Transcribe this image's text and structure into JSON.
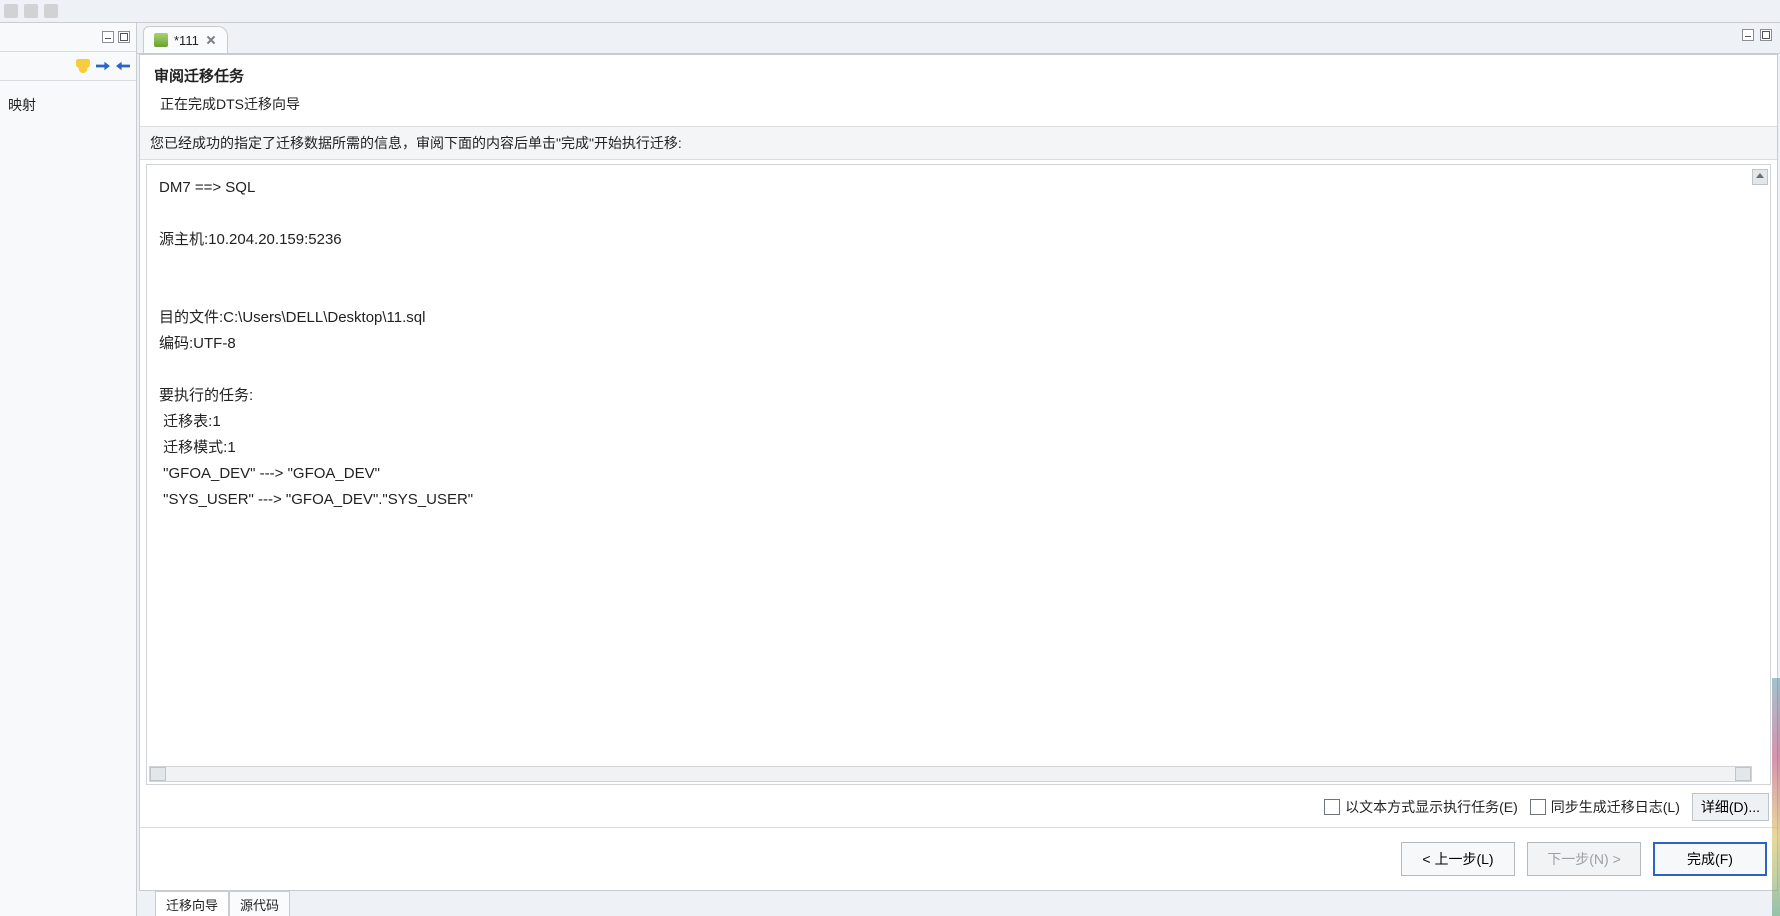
{
  "toolbar_icons": {
    "cut": "cut-icon",
    "copy": "copy-icon",
    "paste": "paste-icon"
  },
  "left_panel": {
    "iconbar": {
      "cluster": "cluster-icon",
      "import": "import-icon",
      "export": "export-icon"
    },
    "tree_root": "映射"
  },
  "tab": {
    "label": "*111"
  },
  "wizard": {
    "title": "审阅迁移任务",
    "subtitle": "正在完成DTS迁移向导",
    "hint": "您已经成功的指定了迁移数据所需的信息，审阅下面的内容后单击\"完成\"开始执行迁移:"
  },
  "review": {
    "lines": [
      "DM7 ==> SQL",
      "",
      "源主机:10.204.20.159:5236",
      "",
      "",
      "目的文件:C:\\Users\\DELL\\Desktop\\11.sql",
      "编码:UTF-8",
      "",
      "要执行的任务:",
      " 迁移表:1",
      " 迁移模式:1",
      " \"GFOA_DEV\" ---> \"GFOA_DEV\"",
      " \"SYS_USER\" ---> \"GFOA_DEV\".\"SYS_USER\""
    ]
  },
  "options": {
    "show_as_text": "以文本方式显示执行任务(E)",
    "gen_log": "同步生成迁移日志(L)",
    "details_btn": "详细(D)..."
  },
  "nav": {
    "back": "< 上一步(L)",
    "next": "下一步(N) >",
    "finish": "完成(F)"
  },
  "bottom_tabs": {
    "wizard": "迁移向导",
    "source": "源代码"
  }
}
